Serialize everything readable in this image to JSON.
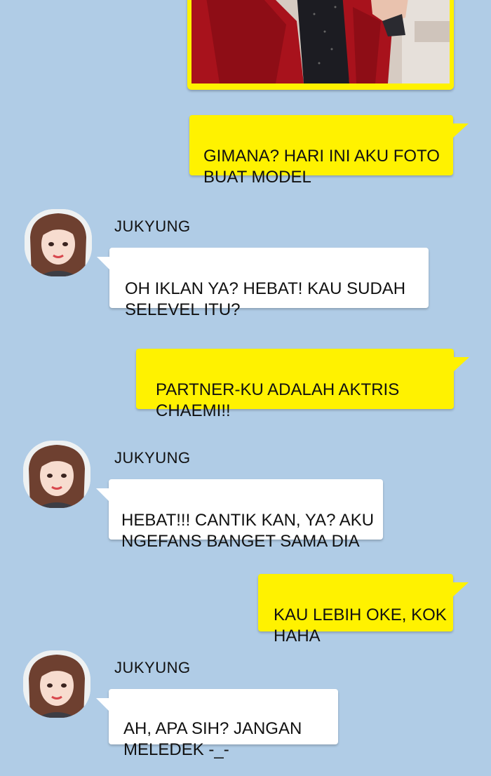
{
  "contact": {
    "name": "JUKYUNG"
  },
  "messages": [
    {
      "side": "out",
      "text": "GIMANA? HARI INI AKU FOTO\nBUAT MODEL"
    },
    {
      "side": "in",
      "sender": "JUKYUNG",
      "text": "OH IKLAN YA? HEBAT! KAU SUDAH\nSELEVEL ITU?"
    },
    {
      "side": "out",
      "text": "PARTNER-KU ADALAH AKTRIS\nCHAEMI!!"
    },
    {
      "side": "in",
      "sender": "JUKYUNG",
      "text": "HEBAT!!! CANTIK KAN, YA? AKU\nNGEFANS BANGET SAMA DIA"
    },
    {
      "side": "out",
      "text": "KAU LEBIH OKE, KOK\nHAHA"
    },
    {
      "side": "in",
      "sender": "JUKYUNG",
      "text": "AH, APA SIH? JANGAN\nMELEDEK -_-"
    }
  ],
  "colors": {
    "background": "#b0cce6",
    "outgoing_bubble": "#fff200",
    "incoming_bubble": "#ffffff"
  }
}
